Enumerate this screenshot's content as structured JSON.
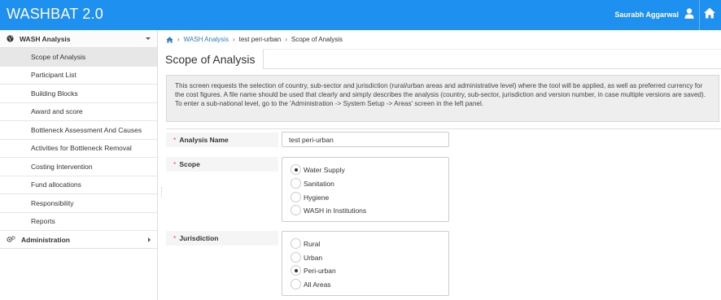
{
  "app": {
    "title": "WASHBAT 2.0",
    "user_name": "Saurabh Aggarwal"
  },
  "colors": {
    "topbar": "#1e90ef",
    "link": "#2b7ec8",
    "required": "#d9534f",
    "active_item_bg": "#e7e7e7"
  },
  "icons": {
    "user": "user-icon",
    "home": "home-icon",
    "globe": "globe-icon",
    "cogs": "cogs-icon"
  },
  "sidebar": {
    "wash_analysis": {
      "label": "WASH Analysis",
      "items": [
        {
          "label": "Scope of Analysis",
          "active": true
        },
        {
          "label": "Participant List"
        },
        {
          "label": "Building Blocks"
        },
        {
          "label": "Award and score"
        },
        {
          "label": "Bottleneck Assessment And Causes"
        },
        {
          "label": "Activities for Bottleneck Removal"
        },
        {
          "label": "Costing Intervention"
        },
        {
          "label": "Fund allocations"
        },
        {
          "label": "Responsibility"
        },
        {
          "label": "Reports"
        }
      ]
    },
    "administration": {
      "label": "Administration"
    }
  },
  "breadcrumb": {
    "section": "WASH Analysis",
    "analysis": "test peri-urban",
    "page": "Scope of Analysis"
  },
  "page": {
    "title": "Scope of Analysis"
  },
  "info_text": "This screen requests the selection of country, sub-sector and jurisdiction (rural/urban areas and administrative level) where the tool will be applied, as well as preferred currency for the cost figures. A file name should be used that clearly and simply describes the analysis (country, sub-sector, jurisdiction and version number, in case multiple versions are saved). To enter a sub-national level, go to the 'Administration -> System Setup -> Areas' screen in the left panel.",
  "form": {
    "analysis_name": {
      "label": "Analysis Name",
      "value": "test peri-urban"
    },
    "scope": {
      "label": "Scope",
      "options": [
        "Water Supply",
        "Sanitation",
        "Hygiene",
        "WASH in Institutions"
      ],
      "selected": "Water Supply"
    },
    "jurisdiction": {
      "label": "Jurisdiction",
      "options": [
        "Rural",
        "Urban",
        "Peri-urban",
        "All Areas"
      ],
      "selected": "Peri-urban"
    }
  }
}
